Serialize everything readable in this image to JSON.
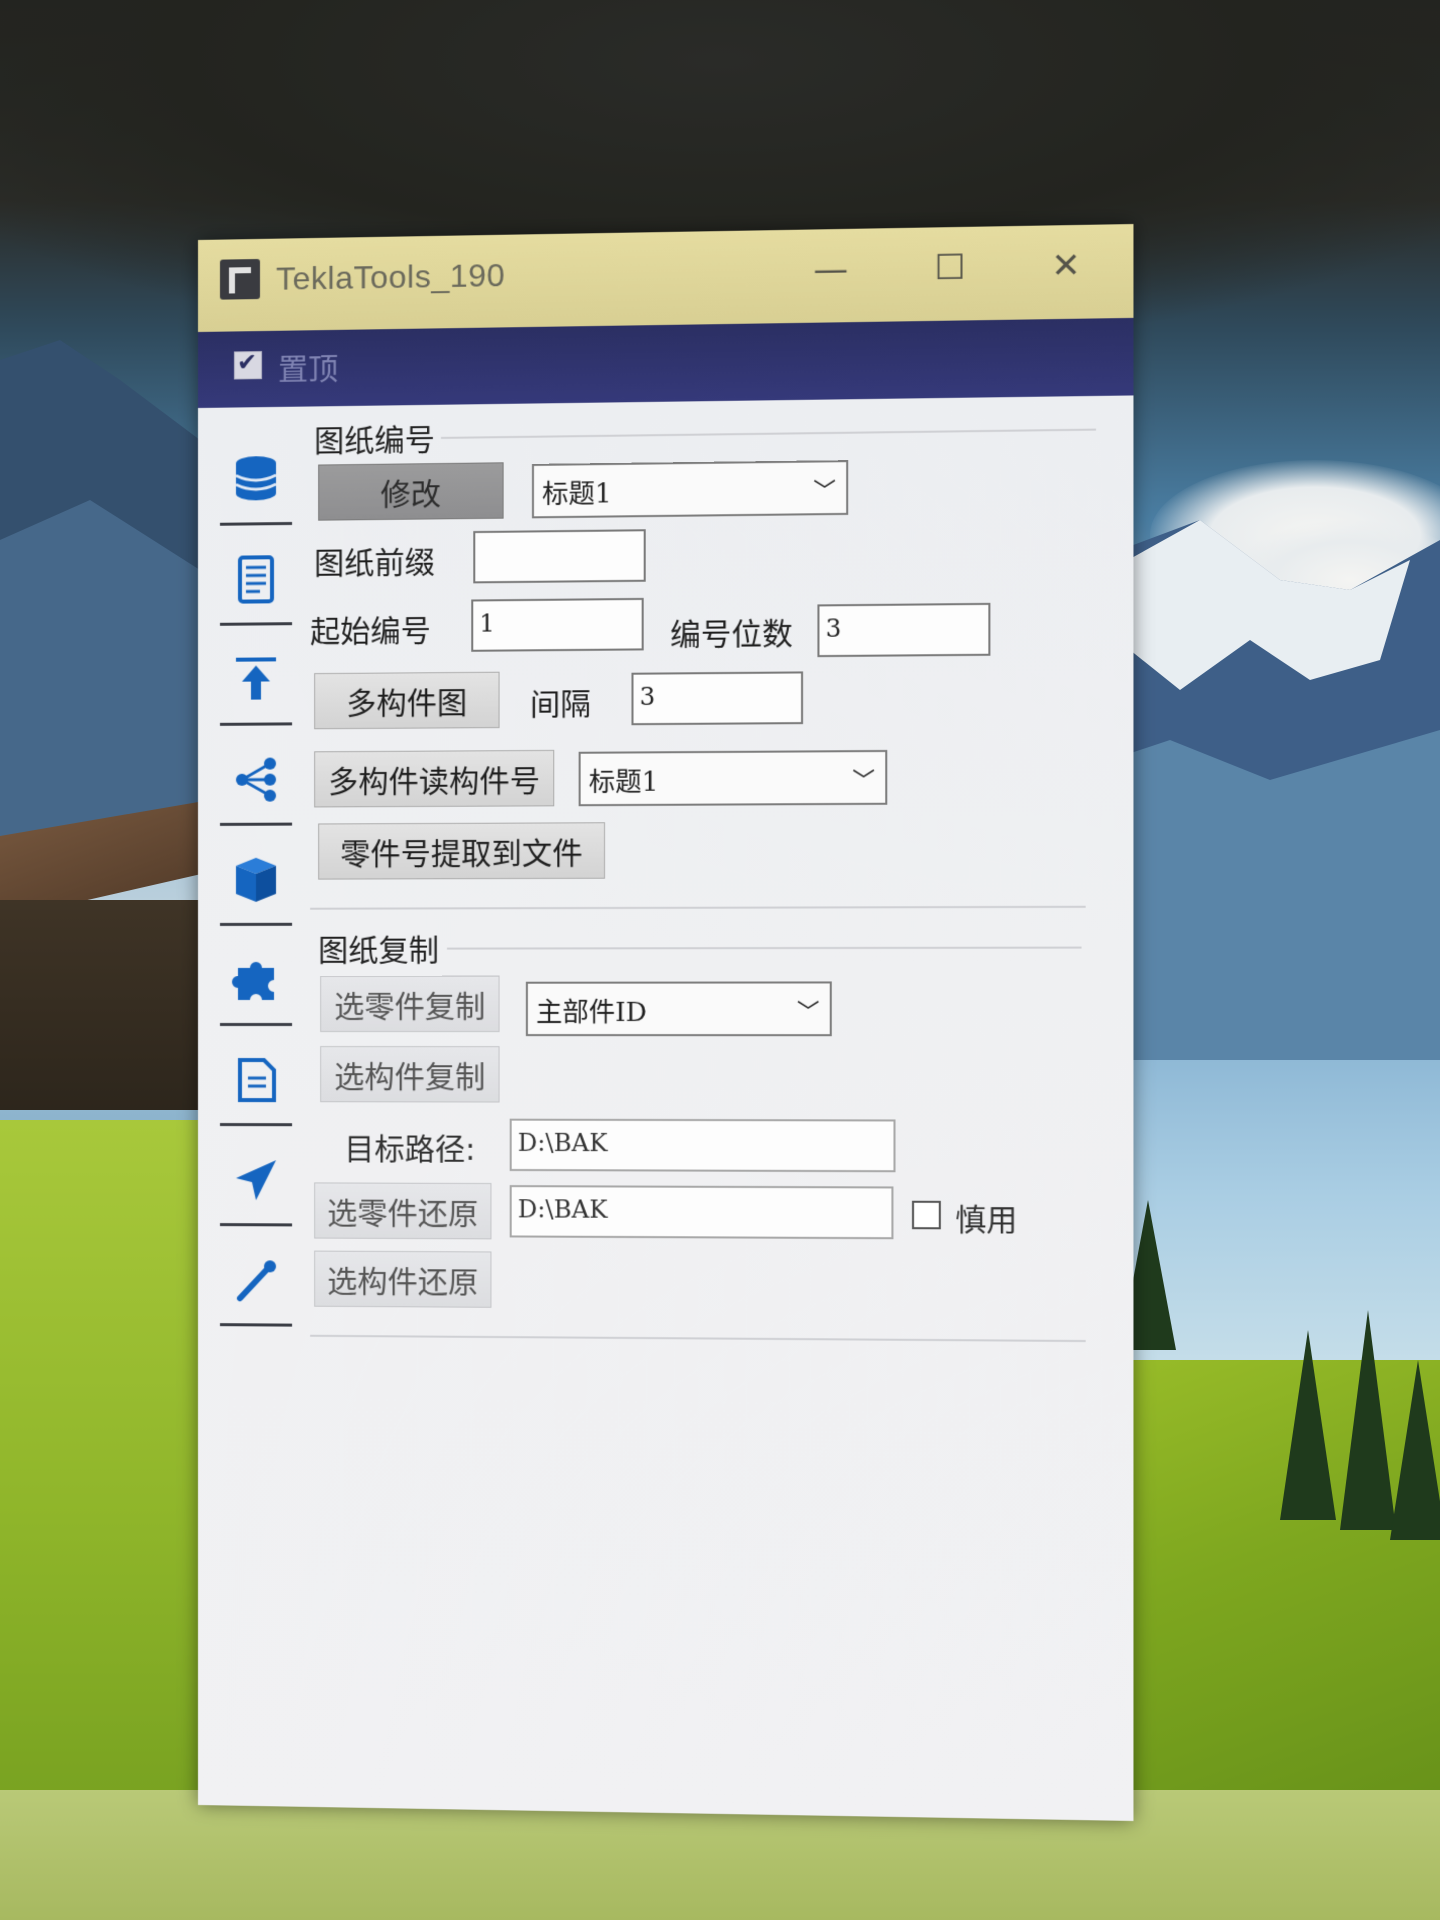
{
  "window": {
    "title": "TeklaTools_190",
    "minimize_glyph": "—",
    "maximize_glyph": "☐",
    "close_glyph": "✕",
    "accent": "#2b2f63",
    "titlebar_color": "#e5dca0"
  },
  "topbar": {
    "pin_label": "置顶",
    "pin_checked": true
  },
  "toolstrip": {
    "items": [
      {
        "icon": "database-icon"
      },
      {
        "icon": "scroll-icon"
      },
      {
        "icon": "upload-arrow-icon"
      },
      {
        "icon": "share-nodes-icon"
      },
      {
        "icon": "book-icon"
      },
      {
        "icon": "puzzle-icon"
      },
      {
        "icon": "document-icon"
      },
      {
        "icon": "send-arrow-icon"
      },
      {
        "icon": "dropper-icon"
      }
    ],
    "icon_color": "#1565c0"
  },
  "numbering": {
    "group_title": "图纸编号",
    "modify_button": "修改",
    "title_select": "标题1",
    "prefix_label": "图纸前缀",
    "prefix_value": "",
    "start_label": "起始编号",
    "start_value": "1",
    "digits_label": "编号位数",
    "digits_value": "3",
    "multi_button": "多构件图",
    "interval_label": "间隔",
    "interval_value": "3",
    "read_button": "多构件读构件号",
    "read_select": "标题1",
    "extract_button": "零件号提取到文件"
  },
  "copy": {
    "group_title": "图纸复制",
    "part_copy_button": "选零件复制",
    "id_select": "主部件ID",
    "assembly_copy_button": "选构件复制",
    "target_label": "目标路径:",
    "target_value": "D:\\BAK",
    "part_restore_button": "选零件还原",
    "restore_value": "D:\\BAK",
    "caution_label": "慎用",
    "caution_checked": false,
    "assembly_restore_button": "选构件还原"
  }
}
